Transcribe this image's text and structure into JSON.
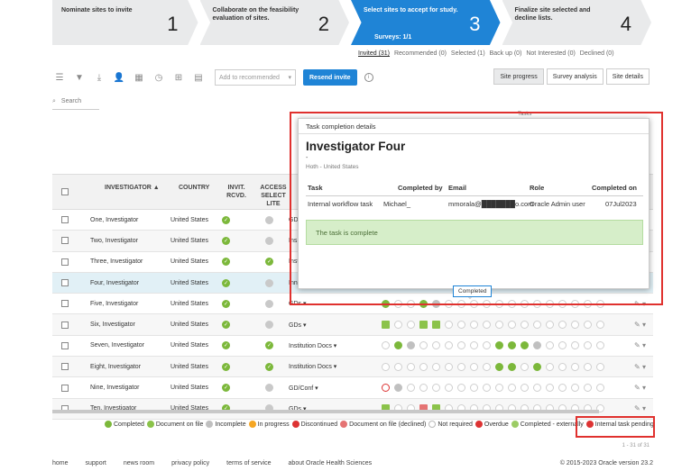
{
  "stepper": [
    {
      "label": "Nominate sites to invite",
      "num": "1",
      "sub": ""
    },
    {
      "label": "Collaborate on the feasibility evaluation of sites.",
      "num": "2",
      "sub": ""
    },
    {
      "label": "Select sites to accept for study.",
      "num": "3",
      "sub": "Surveys: 1/1"
    },
    {
      "label": "Finalize site selected and decline lists.",
      "num": "4",
      "sub": ""
    }
  ],
  "filter_tabs": [
    "Invited (31)",
    "Recommended (0)",
    "Selected (1)",
    "Back up (0)",
    "Not Interested (0)",
    "Declined (0)"
  ],
  "toolbar": {
    "add_to_recommended": "Add to recommended",
    "resend_invite": "Resend invite",
    "views": [
      "Site progress",
      "Survey analysis",
      "Site details"
    ]
  },
  "search": {
    "placeholder": "Search"
  },
  "table": {
    "headers": {
      "investigator": "INVESTIGATOR ▲",
      "country": "COUNTRY",
      "invit": "INVIT. RCVD.",
      "access": "ACCESS SELECT LITE"
    },
    "rows": [
      {
        "name": "One, Investigator",
        "country": "United States",
        "access": "gray",
        "task": "GD",
        "dots": []
      },
      {
        "name": "Two, Investigator",
        "country": "United States",
        "access": "gray",
        "task": "Ins",
        "dots": []
      },
      {
        "name": "Three, Investigator",
        "country": "United States",
        "access": "green",
        "task": "Inst",
        "dots": []
      },
      {
        "name": "Four, Investigator",
        "country": "United States",
        "access": "gray",
        "task": "InnnTask ▾",
        "dots": [
          "e",
          "e",
          "e",
          "e",
          "e",
          "e",
          "g",
          "g",
          "gy",
          "e",
          "e",
          "e",
          "e",
          "e",
          "e",
          "e",
          "e",
          "e"
        ]
      },
      {
        "name": "Five, Investigator",
        "country": "United States",
        "access": "gray",
        "task": "GDs ▾",
        "dots": [
          "g",
          "e",
          "e",
          "g",
          "gy",
          "e",
          "e",
          "e",
          "e",
          "e",
          "e",
          "e",
          "e",
          "e",
          "e",
          "e",
          "e",
          "e"
        ]
      },
      {
        "name": "Six, Investigator",
        "country": "United States",
        "access": "gray",
        "task": "GDs ▾",
        "dots": [
          "doc",
          "e",
          "e",
          "doc",
          "doc",
          "e",
          "e",
          "e",
          "e",
          "e",
          "e",
          "e",
          "e",
          "e",
          "e",
          "e",
          "e",
          "e"
        ]
      },
      {
        "name": "Seven, Investigator",
        "country": "United States",
        "access": "green",
        "task": "Institution Docs ▾",
        "dots": [
          "e",
          "g",
          "gy",
          "e",
          "e",
          "e",
          "e",
          "e",
          "e",
          "g",
          "g",
          "g",
          "gy",
          "e",
          "e",
          "e",
          "e",
          "e"
        ]
      },
      {
        "name": "Eight, Investigator",
        "country": "United States",
        "access": "green",
        "task": "Institution Docs ▾",
        "dots": [
          "e",
          "e",
          "e",
          "e",
          "e",
          "e",
          "e",
          "e",
          "e",
          "g",
          "g",
          "e",
          "g",
          "e",
          "e",
          "e",
          "e",
          "e"
        ]
      },
      {
        "name": "Nine, Investigator",
        "country": "United States",
        "access": "gray",
        "task": "GD/Conf ▾",
        "dots": [
          "ov",
          "gy",
          "e",
          "e",
          "e",
          "e",
          "e",
          "e",
          "e",
          "e",
          "e",
          "e",
          "e",
          "e",
          "e",
          "e",
          "e",
          "e"
        ]
      },
      {
        "name": "Ten, Investigator",
        "country": "United States",
        "access": "gray",
        "task": "GDs ▾",
        "dots": [
          "doc",
          "e",
          "e",
          "docr",
          "doc",
          "e",
          "e",
          "e",
          "e",
          "e",
          "e",
          "e",
          "e",
          "e",
          "e",
          "e",
          "e",
          "e"
        ]
      }
    ]
  },
  "legend": [
    {
      "label": "Completed",
      "color": "#7cb83b"
    },
    {
      "label": "Document on file",
      "color": "#8bc34a"
    },
    {
      "label": "Incomplete",
      "color": "#c0c0c0"
    },
    {
      "label": "In progress",
      "color": "#f5a623"
    },
    {
      "label": "Discontinued",
      "color": "#d33"
    },
    {
      "label": "Document on file (declined)",
      "color": "#e57373"
    },
    {
      "label": "Not required",
      "color": "#ffffff"
    },
    {
      "label": "Overdue",
      "color": "#d33"
    },
    {
      "label": "Completed - externally",
      "color": "#9ccc65"
    },
    {
      "label": "Internal task pending",
      "color": "#d33"
    }
  ],
  "pager": "1 - 31 of 31",
  "popup": {
    "header": "Task completion details",
    "title": "Investigator Four",
    "dash": "-",
    "location": "Hoth - United States",
    "columns": [
      "Task",
      "Completed by",
      "Email",
      "Role",
      "Completed on"
    ],
    "values": [
      "Internal workflow task",
      "Michael_",
      "mmorala@███████o.com",
      "Oracle Admin user",
      "07Jul2023"
    ],
    "message": "The task is complete",
    "tasks_label": "Tasks"
  },
  "tooltip": "Completed",
  "footer": {
    "links": [
      "home",
      "support",
      "news room",
      "privacy policy",
      "terms of service",
      "about Oracle Health Sciences"
    ],
    "copyright": "© 2015-2023 Oracle   version 23.2"
  }
}
